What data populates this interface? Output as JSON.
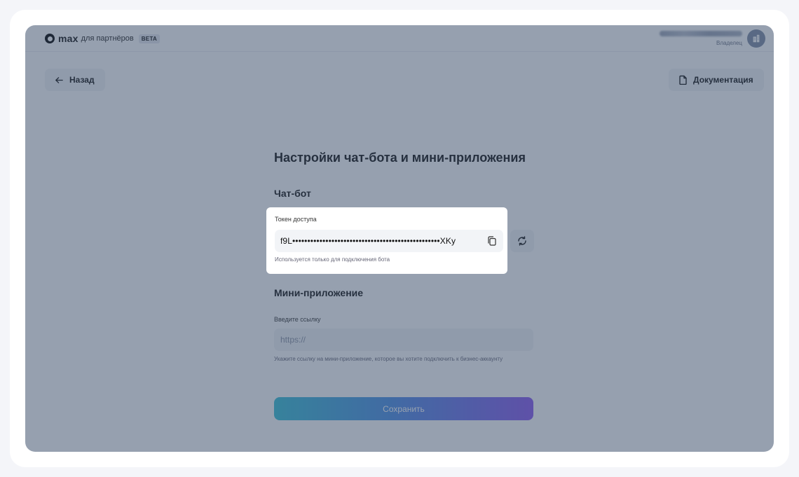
{
  "header": {
    "logo_text": "max",
    "logo_subtitle": "для партнёров",
    "badge": "BETA",
    "user_role": "Владелец"
  },
  "nav": {
    "back_label": "Назад",
    "docs_label": "Документация"
  },
  "panel": {
    "title": "Настройки чат-бота и мини-приложения",
    "chatbot": {
      "section_title": "Чат-бот",
      "token_label": "Токен доступа",
      "token_value": "f9L•••••••••••••••••••••••••••••••••••••••••••••••••XKy",
      "token_hint": "Используется только для подключения бота"
    },
    "miniapp": {
      "section_title": "Мини-приложение",
      "link_label": "Введите ссылку",
      "link_placeholder": "https://",
      "link_hint": "Укажите ссылку на мини-приложение, которое вы хотите подключить к бизнес-аккаунту"
    },
    "save_label": "Сохранить"
  },
  "icons": {
    "logo": "max-logo-icon",
    "avatar": "building-icon",
    "back": "arrow-left-icon",
    "docs": "document-icon",
    "copy": "copy-icon",
    "refresh": "refresh-icon"
  },
  "colors": {
    "overlay": "#384c68",
    "save_gradient_start": "#36c0d6",
    "save_gradient_end": "#8a57f0",
    "avatar": "#7d8aa3"
  }
}
